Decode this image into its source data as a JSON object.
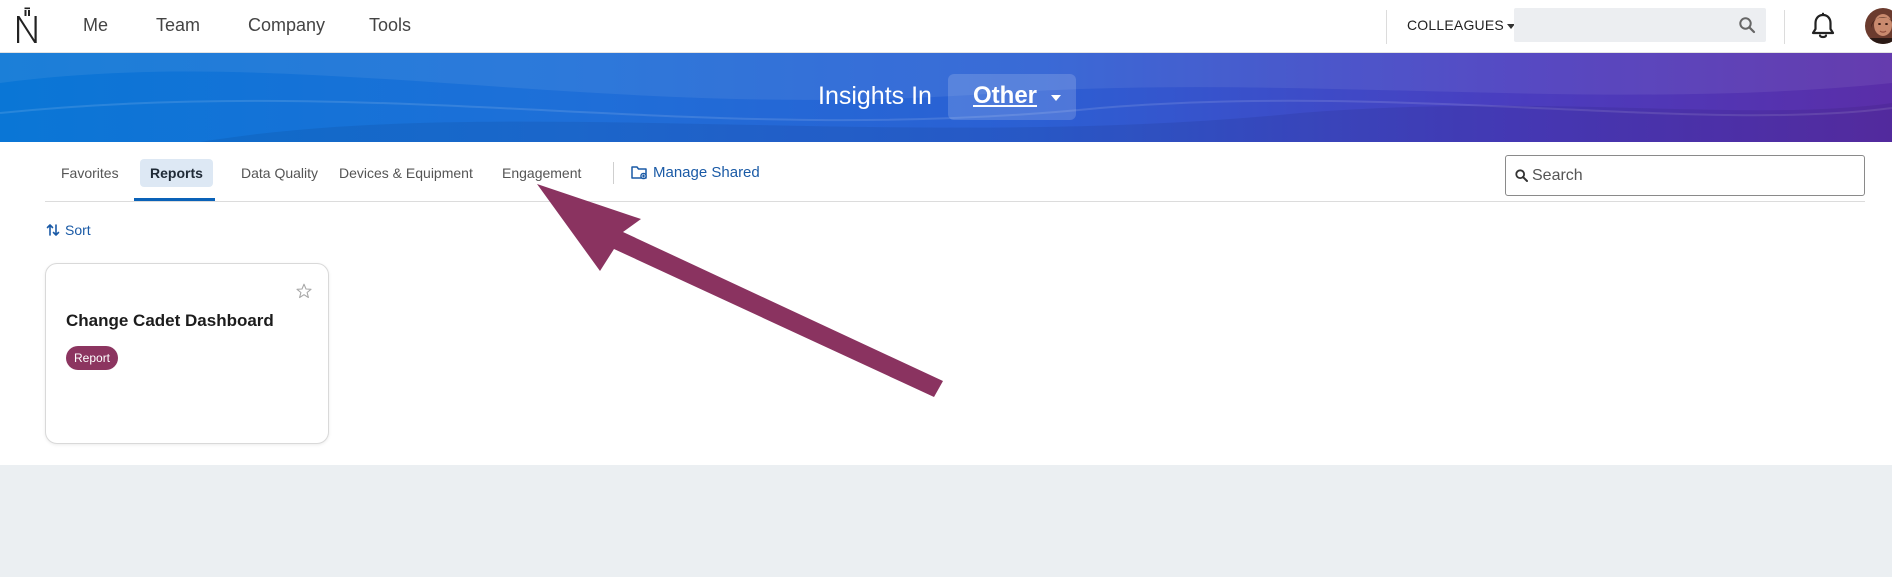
{
  "topnav": {
    "links": [
      "Me",
      "Team",
      "Company",
      "Tools"
    ],
    "colleagues_label": "COLLEAGUES",
    "search_value": "",
    "search_icon": "search-icon",
    "bell_icon": "bell-icon"
  },
  "banner": {
    "title": "Insights In",
    "selected": "Other"
  },
  "tabs": [
    {
      "label": "Favorites",
      "active": false
    },
    {
      "label": "Reports",
      "active": true
    },
    {
      "label": "Data Quality",
      "active": false
    },
    {
      "label": "Devices & Equipment",
      "active": false
    },
    {
      "label": "Engagement",
      "active": false
    }
  ],
  "manage_shared_label": "Manage Shared",
  "page_search": {
    "placeholder": "Search",
    "value": ""
  },
  "sort_label": "Sort",
  "cards": [
    {
      "title": "Change Cadet Dashboard",
      "badge": "Report",
      "favorited": false
    }
  ],
  "colors": {
    "accent": "#1a5aa6",
    "badge": "#8c3560",
    "annotation_arrow": "#8a3360",
    "banner_start": "#0a76d6",
    "banner_end": "#5a2ea8"
  }
}
